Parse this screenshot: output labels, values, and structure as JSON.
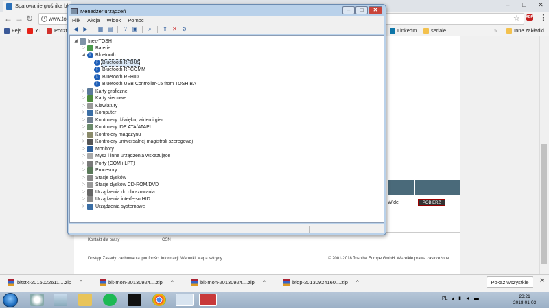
{
  "browser": {
    "tab_title": "Sparowanie głośnika bl",
    "window_controls": [
      "–",
      "□",
      "✕"
    ],
    "address": "www.to",
    "bookmarks": [
      {
        "label": "Fejs",
        "color": "#3b5998"
      },
      {
        "label": "YT",
        "color": "#e62117"
      },
      {
        "label": "Poczt",
        "color": "#d0312d"
      },
      {
        "label": "LinkedIn",
        "color": "#0e76a8"
      },
      {
        "label": "seriale",
        "color": "#f3c14d"
      },
      {
        "label": "Inne zakładki",
        "color": "#f3c14d"
      }
    ]
  },
  "page": {
    "download_edition": "Wide",
    "download_button": "POBIERZ",
    "contact_label": "Kontakt dla prasy",
    "contact_value": "CSN",
    "footer_links": "Dostęp   Zasady zachowania poufności informacji   Warunki   Mapa witryny",
    "copyright": "© 2001-2018 Toshiba Europe GmbH. Wszelkie prawa zastrzeżone."
  },
  "device_manager": {
    "title": "Menedżer urządzeń",
    "menu": [
      "Plik",
      "Akcja",
      "Widok",
      "Pomoc"
    ],
    "tree": {
      "root": "Inez-TOSH",
      "items": [
        {
          "label": "Baterie",
          "expanded": false
        },
        {
          "label": "Bluetooth",
          "expanded": true,
          "children": [
            "Bluetooth RFBUS",
            "Bluetooth RFCOMM",
            "Bluetooth RFHID",
            "Bluetooth USB Controller-15 from TOSHIBA"
          ]
        },
        {
          "label": "Karty graficzne",
          "expanded": false
        },
        {
          "label": "Karty sieciowe",
          "expanded": false
        },
        {
          "label": "Klawiatury",
          "expanded": false
        },
        {
          "label": "Komputer",
          "expanded": false
        },
        {
          "label": "Kontrolery dźwięku, wideo i gier",
          "expanded": false
        },
        {
          "label": "Kontrolery IDE ATA/ATAPI",
          "expanded": false
        },
        {
          "label": "Kontrolery magazynu",
          "expanded": false
        },
        {
          "label": "Kontrolery uniwersalnej magistrali szeregowej",
          "expanded": false
        },
        {
          "label": "Monitory",
          "expanded": false
        },
        {
          "label": "Mysz i inne urządzenia wskazujące",
          "expanded": false
        },
        {
          "label": "Porty (COM i LPT)",
          "expanded": false
        },
        {
          "label": "Procesory",
          "expanded": false
        },
        {
          "label": "Stacje dysków",
          "expanded": false
        },
        {
          "label": "Stacje dysków CD-ROM/DVD",
          "expanded": false
        },
        {
          "label": "Urządzenia do obrazowania",
          "expanded": false
        },
        {
          "label": "Urządzenia interfejsu HID",
          "expanded": false
        },
        {
          "label": "Urządzenia systemowe",
          "expanded": false
        }
      ],
      "selected": "Bluetooth RFBUS"
    }
  },
  "downloads": {
    "items": [
      "bltstk-2015022611....zip",
      "blt-mon-20130924....zip",
      "blt-mon-20130924....zip",
      "bfdp-20130924160....zip"
    ],
    "show_all": "Pokaż wszystkie"
  },
  "taskbar": {
    "language": "PL",
    "time": "23:21",
    "date": "2018-01-03"
  }
}
